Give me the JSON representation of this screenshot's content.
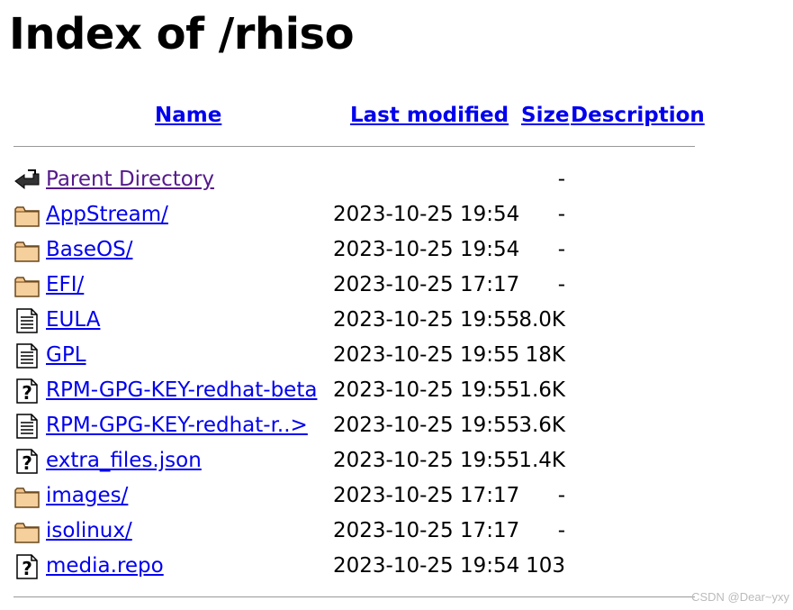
{
  "page": {
    "title": "Index of /rhiso"
  },
  "columns": {
    "name": "Name",
    "last_modified": "Last modified",
    "size": "Size",
    "description": "Description"
  },
  "rows": [
    {
      "name": "Parent Directory",
      "date": "",
      "size": "-",
      "icon": "back-icon"
    },
    {
      "name": "AppStream/",
      "date": "2023-10-25 19:54",
      "size": "-",
      "icon": "folder-icon"
    },
    {
      "name": "BaseOS/",
      "date": "2023-10-25 19:54",
      "size": "-",
      "icon": "folder-icon"
    },
    {
      "name": "EFI/",
      "date": "2023-10-25 17:17",
      "size": "-",
      "icon": "folder-icon"
    },
    {
      "name": "EULA",
      "date": "2023-10-25 19:55",
      "size": "8.0K",
      "icon": "text-file-icon"
    },
    {
      "name": "GPL",
      "date": "2023-10-25 19:55",
      "size": "18K",
      "icon": "text-file-icon"
    },
    {
      "name": "RPM-GPG-KEY-redhat-beta",
      "date": "2023-10-25 19:55",
      "size": "1.6K",
      "icon": "unknown-file-icon"
    },
    {
      "name": "RPM-GPG-KEY-redhat-r..>",
      "date": "2023-10-25 19:55",
      "size": "3.6K",
      "icon": "text-file-icon"
    },
    {
      "name": "extra_files.json",
      "date": "2023-10-25 19:55",
      "size": "1.4K",
      "icon": "unknown-file-icon"
    },
    {
      "name": "images/",
      "date": "2023-10-25 17:17",
      "size": "-",
      "icon": "folder-icon"
    },
    {
      "name": "isolinux/",
      "date": "2023-10-25 17:17",
      "size": "-",
      "icon": "folder-icon"
    },
    {
      "name": "media.repo",
      "date": "2023-10-25 19:54",
      "size": "103",
      "icon": "unknown-file-icon"
    }
  ],
  "watermark": "CSDN @Dear~yxy",
  "colors": {
    "link": "#0000ee",
    "visited": "#551a8b",
    "rule": "#999999"
  }
}
